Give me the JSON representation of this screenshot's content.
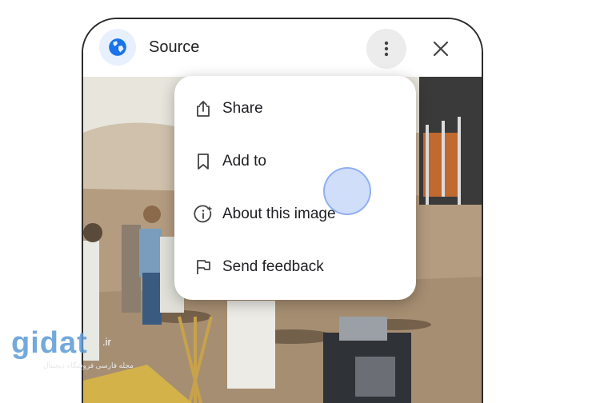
{
  "header": {
    "title": "Source",
    "icons": {
      "source": "globe-icon",
      "more": "more-vert-icon",
      "close": "close-icon"
    }
  },
  "menu": {
    "items": [
      {
        "label": "Share",
        "icon": "share-icon"
      },
      {
        "label": "Add to",
        "icon": "bookmark-icon"
      },
      {
        "label": "About this image",
        "icon": "info-sparkle-icon"
      },
      {
        "label": "Send feedback",
        "icon": "flag-icon"
      }
    ]
  },
  "watermark": {
    "logo": "gidat",
    "tld": ".ir",
    "tagline": "مجله فارسی فروشگاه دیجیتال"
  },
  "colors": {
    "accent": "#1a73e8",
    "menu_bg": "#ffffff",
    "text": "#202124",
    "touch": "#a9c3f5"
  }
}
